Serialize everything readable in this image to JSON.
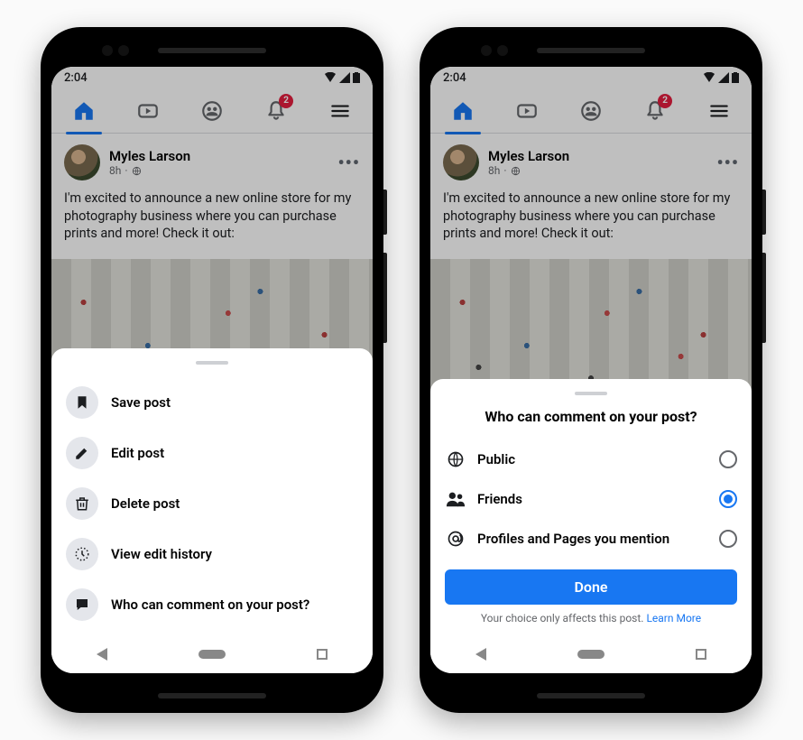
{
  "status": {
    "time": "2:04"
  },
  "nav": {
    "notification_count": "2"
  },
  "post": {
    "author": "Myles Larson",
    "time": "8h",
    "text": "I'm excited to announce a new online store for my photography business where you can purchase prints and more! Check it out:"
  },
  "menu": {
    "items": [
      {
        "label": "Save post",
        "icon": "bookmark"
      },
      {
        "label": "Edit post",
        "icon": "pencil"
      },
      {
        "label": "Delete post",
        "icon": "trash"
      },
      {
        "label": "View edit history",
        "icon": "history"
      },
      {
        "label": "Who can comment on your post?",
        "icon": "comment"
      }
    ]
  },
  "comment_sheet": {
    "title": "Who can comment on your post?",
    "options": [
      {
        "label": "Public",
        "selected": false,
        "icon": "globe"
      },
      {
        "label": "Friends",
        "selected": true,
        "icon": "friends"
      },
      {
        "label": "Profiles and Pages you mention",
        "selected": false,
        "icon": "at"
      }
    ],
    "done_label": "Done",
    "footer_text": "Your choice only affects this post. ",
    "learn_more": "Learn More"
  }
}
